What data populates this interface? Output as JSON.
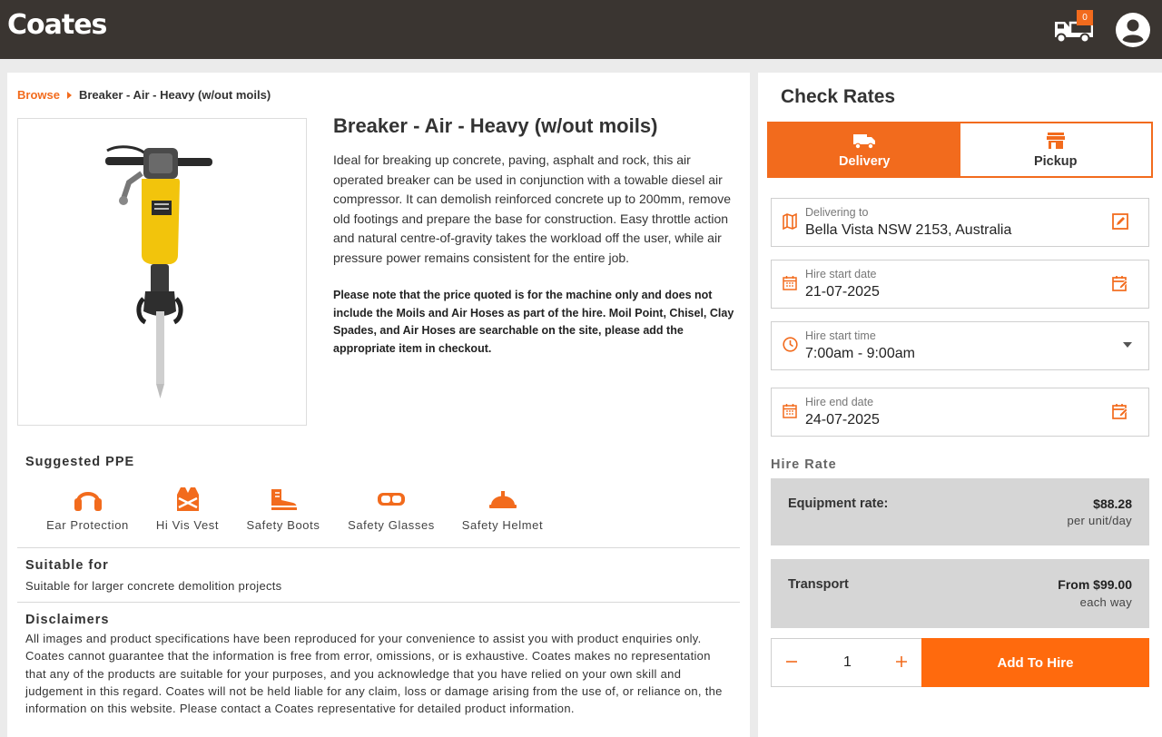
{
  "brand": {
    "name": "Coates",
    "accent": "#F26B1D",
    "header_bg": "#3A3531"
  },
  "header": {
    "cart_count": "0",
    "cart_icon": "truck-icon",
    "account_icon": "user-circle-icon"
  },
  "breadcrumb": {
    "root": "Browse",
    "current": "Breaker - Air - Heavy (w/out moils)"
  },
  "product": {
    "title": "Breaker - Air - Heavy (w/out moils)",
    "description": "Ideal for breaking up concrete, paving, asphalt and rock, this air operated breaker can be used in conjunction with a towable diesel air compressor. It can demolish reinforced concrete up to 200mm, remove old footings and prepare the base for construction. Easy throttle action and natural centre-of-gravity takes the workload off the user, while air pressure power remains consistent for the entire job.",
    "note": "Please note that the price quoted is for the machine only and does not include the Moils and Air Hoses as part of the hire. Moil Point, Chisel, Clay Spades, and Air Hoses are searchable on the site, please add the appropriate item in checkout."
  },
  "ppe": {
    "title": "Suggested PPE",
    "items": [
      {
        "label": "Ear Protection",
        "icon": "ear-muffs-icon"
      },
      {
        "label": "Hi Vis Vest",
        "icon": "vest-icon"
      },
      {
        "label": "Safety Boots",
        "icon": "boot-icon"
      },
      {
        "label": "Safety Glasses",
        "icon": "goggles-icon"
      },
      {
        "label": "Safety Helmet",
        "icon": "helmet-icon"
      }
    ]
  },
  "suitable": {
    "title": "Suitable for",
    "text": "Suitable for larger concrete demolition projects"
  },
  "disclaimers": {
    "title": "Disclaimers",
    "text": "All images and product specifications have been reproduced for your convenience to assist you with product enquiries only. Coates cannot guarantee that the information is free from error, omissions, or is exhaustive. Coates makes no representation that any of the products are suitable for your purposes, and you acknowledge that you have relied on your own skill and judgement in this regard. Coates will not be held liable for any claim, loss or damage arising from the use of, or reliance on, the information on this website. Please contact a Coates representative for detailed product information."
  },
  "check_rates": {
    "title": "Check Rates",
    "tabs": [
      {
        "label": "Delivery",
        "icon": "delivery-truck-icon",
        "active": true
      },
      {
        "label": "Pickup",
        "icon": "store-icon",
        "active": false
      }
    ],
    "delivering_to": {
      "label": "Delivering to",
      "value": "Bella Vista NSW 2153, Australia"
    },
    "hire_start_date": {
      "label": "Hire start date",
      "value": "21-07-2025"
    },
    "hire_start_time": {
      "label": "Hire start time",
      "value": "7:00am - 9:00am"
    },
    "hire_end_date": {
      "label": "Hire end date",
      "value": "24-07-2025"
    },
    "hire_rate_title": "Hire Rate",
    "equipment_rate": {
      "label": "Equipment rate:",
      "value": "$88.28",
      "unit": "per unit/day"
    },
    "transport": {
      "label": "Transport",
      "value": "From $99.00",
      "unit": "each way"
    },
    "quantity": "1",
    "add_button": "Add To Hire"
  }
}
